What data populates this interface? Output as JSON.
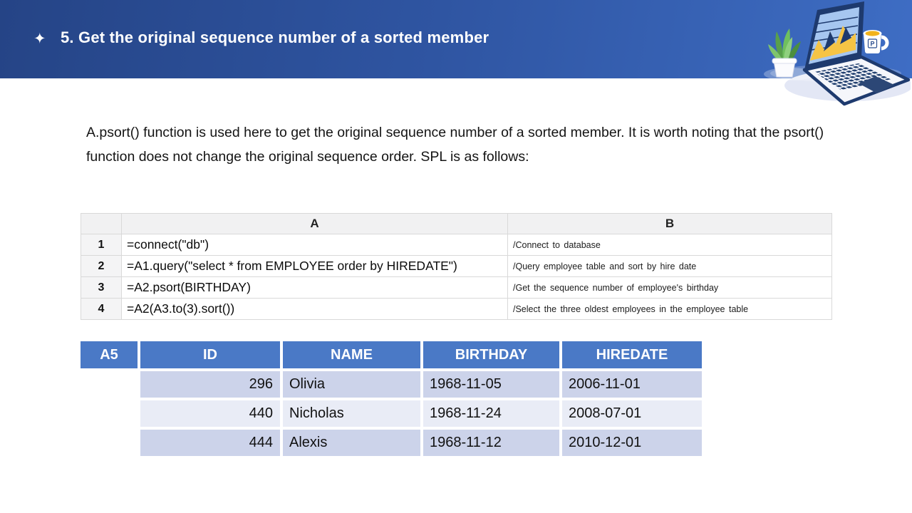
{
  "header": {
    "bullet_icon": "✦",
    "title": "5. Get the original sequence number of a sorted member"
  },
  "intro": {
    "paragraph": "A.psort() function is used here to get the original sequence number of a sorted member. It is worth noting that the psort() function does not change the original sequence order. SPL is as follows:"
  },
  "spl_table": {
    "column_headers": [
      "A",
      "B"
    ],
    "rows": [
      {
        "num": "1",
        "code": "=connect(\"db\")",
        "comment": "/Connect to database"
      },
      {
        "num": "2",
        "code": "=A1.query(\"select * from EMPLOYEE order by HIREDATE\")",
        "comment": "/Query employee table and sort by hire date"
      },
      {
        "num": "3",
        "code": "=A2.psort(BIRTHDAY)",
        "comment": "/Get the sequence number of employee's birthday"
      },
      {
        "num": "4",
        "code": "=A2(A3.to(3).sort())",
        "comment": "/Select the three oldest employees in the employee table"
      }
    ]
  },
  "result_table": {
    "corner_label": "A5",
    "column_headers": [
      "ID",
      "NAME",
      "BIRTHDAY",
      "HIREDATE"
    ],
    "rows": [
      [
        "296",
        "Olivia",
        "1968-11-05",
        "2006-11-01"
      ],
      [
        "440",
        "Nicholas",
        "1968-11-24",
        "2008-07-01"
      ],
      [
        "444",
        "Alexis",
        "1968-11-12",
        "2010-12-01"
      ]
    ]
  },
  "illustration": {
    "icons": [
      "plant-icon",
      "laptop-icon",
      "coffee-mug-icon"
    ],
    "mug_logo": "P"
  },
  "colors": {
    "band_gradient_start": "#254486",
    "band_gradient_end": "#3e6dc4",
    "result_header_blue": "#4a79c6",
    "result_row_dark": "#ccd3ea",
    "result_row_light": "#e9ecf6",
    "laptop_navy": "#1e3a6e",
    "screen_blue": "#a6c6f0",
    "chart_yellow": "#f6c445"
  }
}
